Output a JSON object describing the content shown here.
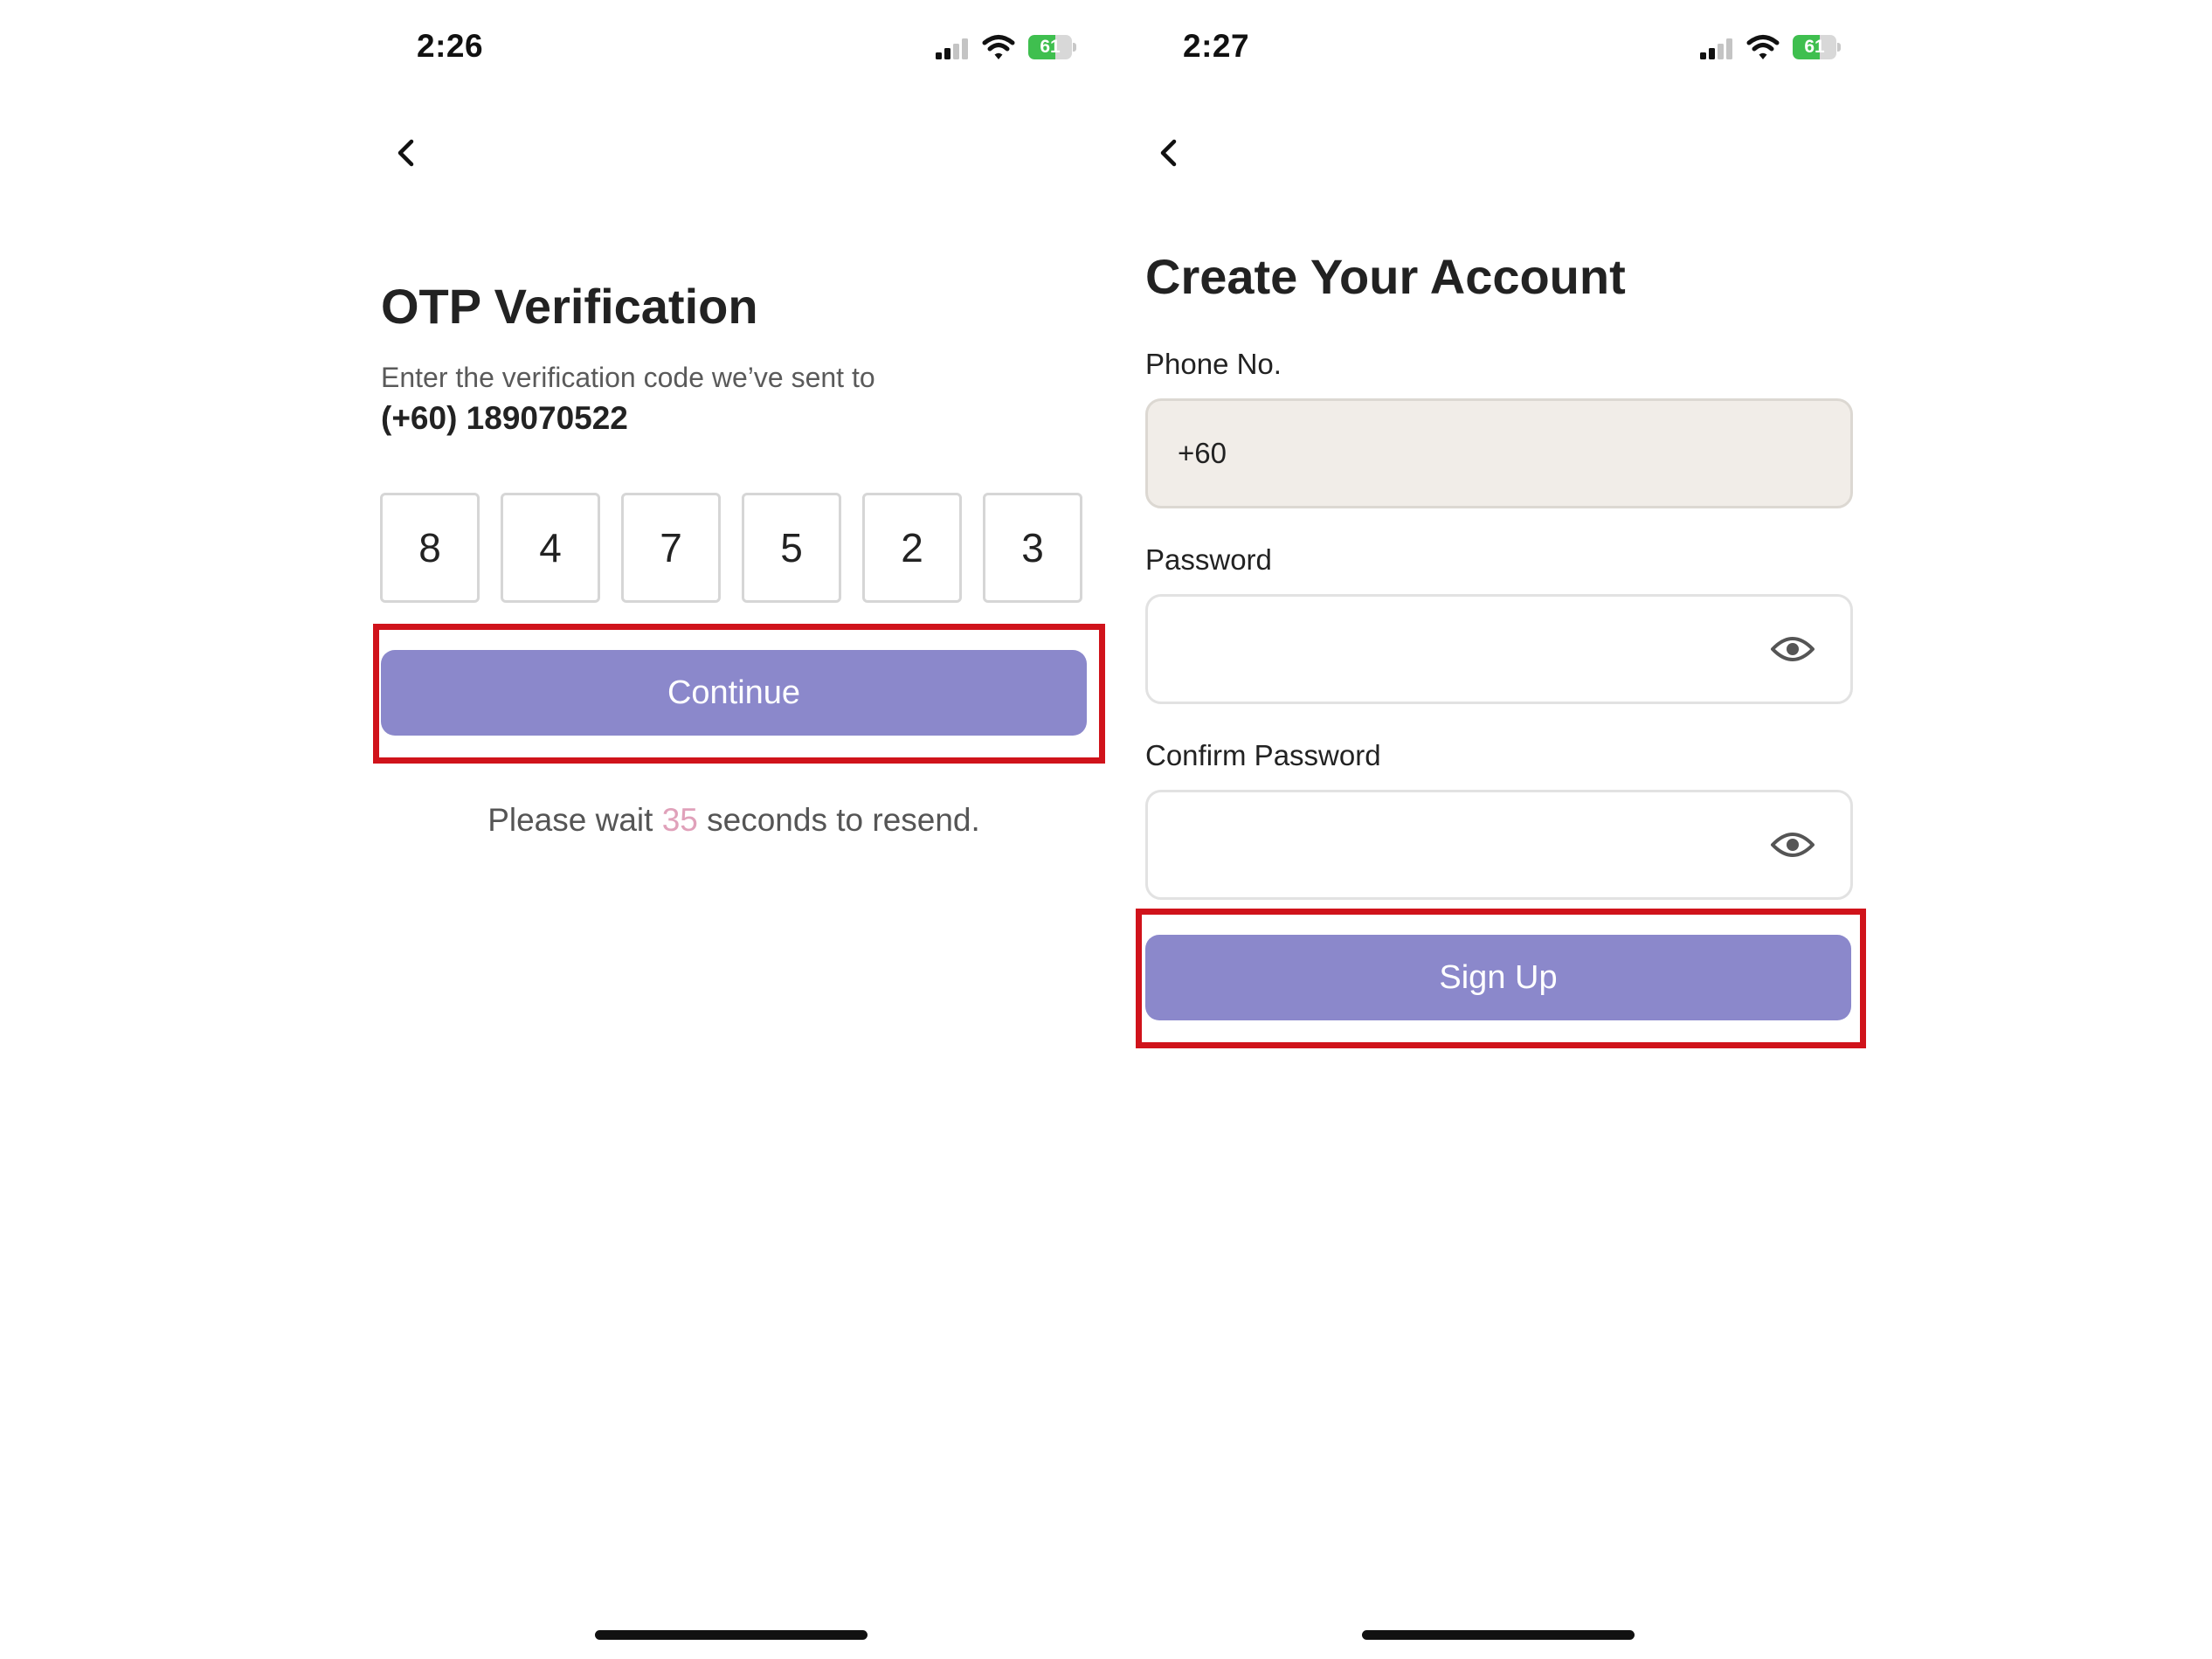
{
  "left_screen": {
    "status_bar": {
      "time": "2:26",
      "battery": "61",
      "battery_level": 0.61,
      "signal_bars_active": 2,
      "signal_bars_total": 4
    },
    "title": "OTP Verification",
    "description": "Enter the verification code we’ve sent to",
    "phone": "(+60) 189070522",
    "otp_digits": [
      "8",
      "4",
      "7",
      "5",
      "2",
      "3"
    ],
    "continue_label": "Continue",
    "resend": {
      "prefix": "Please wait",
      "count": "35",
      "suffix": "seconds to resend."
    }
  },
  "right_screen": {
    "status_bar": {
      "time": "2:27",
      "battery": "61",
      "battery_level": 0.61,
      "signal_bars_active": 2,
      "signal_bars_total": 4
    },
    "title": "Create Your Account",
    "phone_label": "Phone No.",
    "phone_value": "+60",
    "password_label": "Password",
    "password_value": "",
    "confirm_label": "Confirm Password",
    "confirm_value": "",
    "signup_label": "Sign Up"
  },
  "colors": {
    "accent": "#8b88cb",
    "highlight": "#d0131b",
    "countdown": "#e0a1ba",
    "battery_green": "#3fbf4f",
    "filled_field": "#f1ede8"
  },
  "icons": {
    "back": "chevron-left-icon",
    "signal": "signal-icon",
    "wifi": "wifi-icon",
    "battery": "battery-icon",
    "password_toggle": "eye-icon"
  }
}
